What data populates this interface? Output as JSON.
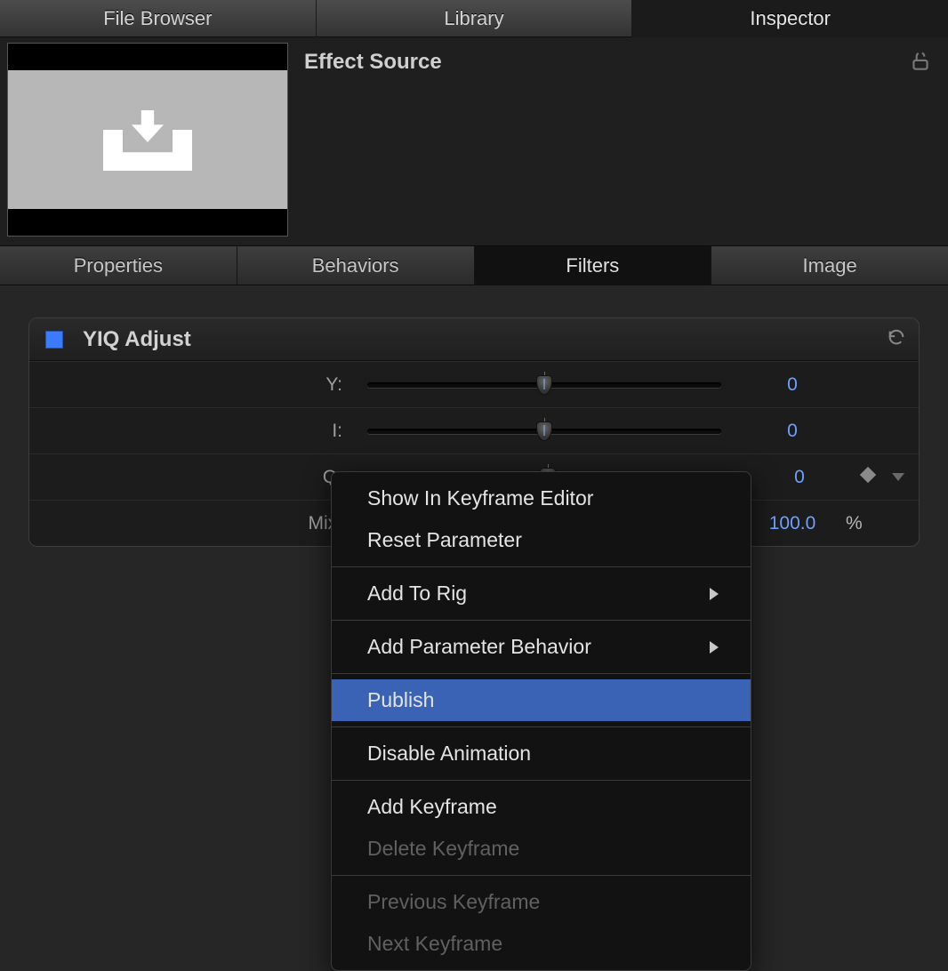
{
  "top_tabs": {
    "file_browser": "File Browser",
    "library": "Library",
    "inspector": "Inspector",
    "active": "inspector"
  },
  "header": {
    "title": "Effect Source"
  },
  "sub_tabs": {
    "properties": "Properties",
    "behaviors": "Behaviors",
    "filters": "Filters",
    "image": "Image",
    "active": "filters"
  },
  "effect": {
    "name": "YIQ Adjust",
    "params": [
      {
        "label": "Y:",
        "value": "0",
        "pos": 50,
        "unit": ""
      },
      {
        "label": "I:",
        "value": "0",
        "pos": 50,
        "unit": ""
      },
      {
        "label": "Q:",
        "value": "0",
        "pos": 50,
        "unit": ""
      },
      {
        "label": "Mix:",
        "value": "100.0",
        "pos": 100,
        "unit": "%"
      }
    ]
  },
  "context_menu": {
    "show_in_keyframe_editor": "Show In Keyframe Editor",
    "reset_parameter": "Reset Parameter",
    "add_to_rig": "Add To Rig",
    "add_parameter_behavior": "Add Parameter Behavior",
    "publish": "Publish",
    "disable_animation": "Disable Animation",
    "add_keyframe": "Add Keyframe",
    "delete_keyframe": "Delete Keyframe",
    "previous_keyframe": "Previous Keyframe",
    "next_keyframe": "Next Keyframe"
  }
}
